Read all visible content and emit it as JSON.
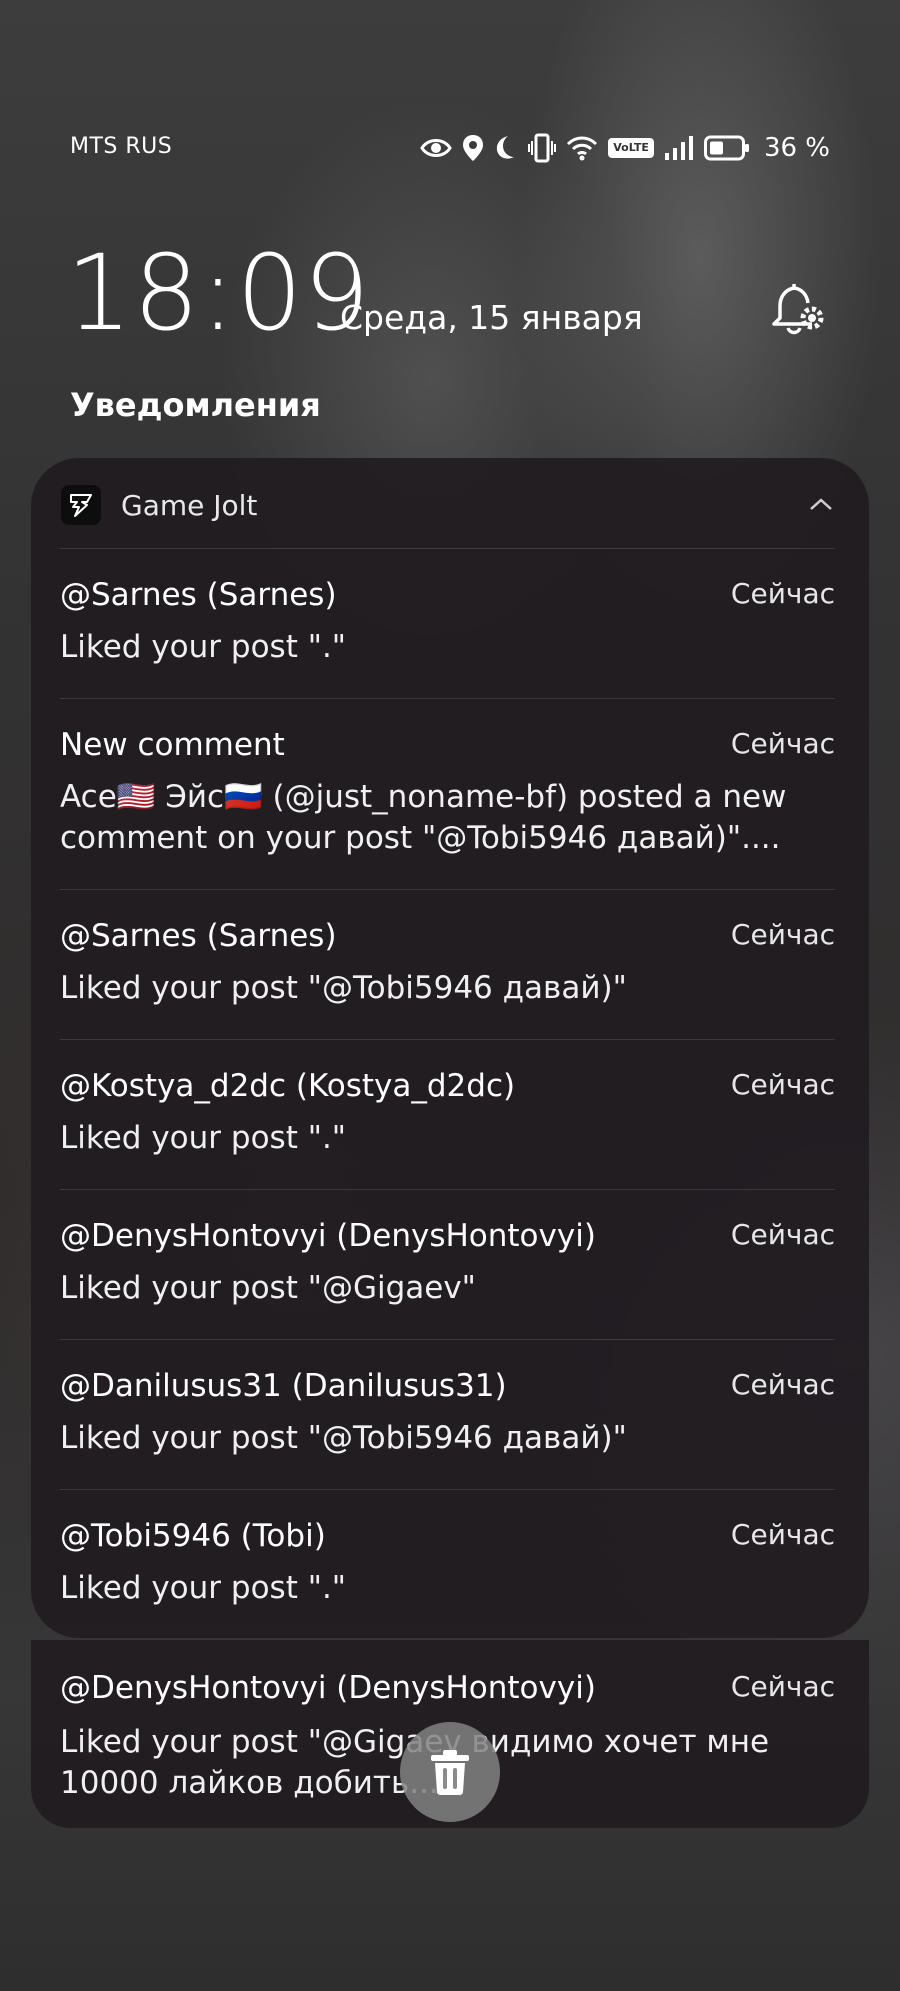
{
  "status_bar": {
    "carrier": "MTS RUS",
    "battery": "36 %",
    "volte": "VoLTE",
    "icons": [
      "eye-icon",
      "location-icon",
      "moon-icon",
      "vibrate-icon",
      "wifi-icon",
      "volte-icon",
      "signal-icon",
      "battery-icon"
    ]
  },
  "lockscreen": {
    "time": "18:09",
    "date": "Среда, 15 января"
  },
  "notifications_title": "Уведомления",
  "group": {
    "app_name": "Game Jolt",
    "items": [
      {
        "title": "@Sarnes (Sarnes)",
        "time": "Сейчас",
        "body": "Liked your post \".\""
      },
      {
        "title": "New comment",
        "time": "Сейчас",
        "body": "Ace🇺🇸 Эйс🇷🇺 (@just_noname-bf) posted a new comment on your post \"@Tobi5946 давай)\"...."
      },
      {
        "title": "@Sarnes (Sarnes)",
        "time": "Сейчас",
        "body": "Liked your post \"@Tobi5946 давай)\""
      },
      {
        "title": "@Kostya_d2dc (Kostya_d2dc)",
        "time": "Сейчас",
        "body": "Liked your post \".\""
      },
      {
        "title": "@DenysHontovyi (DenysHontovyi)",
        "time": "Сейчас",
        "body": "Liked your post \"@Gigaev\""
      },
      {
        "title": "@Danilusus31 (Danilusus31)",
        "time": "Сейчас",
        "body": "Liked your post \"@Tobi5946 давай)\""
      },
      {
        "title": "@Tobi5946 (Tobi)",
        "time": "Сейчас",
        "body": "Liked your post \".\""
      }
    ]
  },
  "extra_notification": {
    "title": "@DenysHontovyi (DenysHontovyi)",
    "time": "Сейчас",
    "body": "Liked your post \"@Gigaev видимо хочет мне 10000 лайков добить..."
  }
}
